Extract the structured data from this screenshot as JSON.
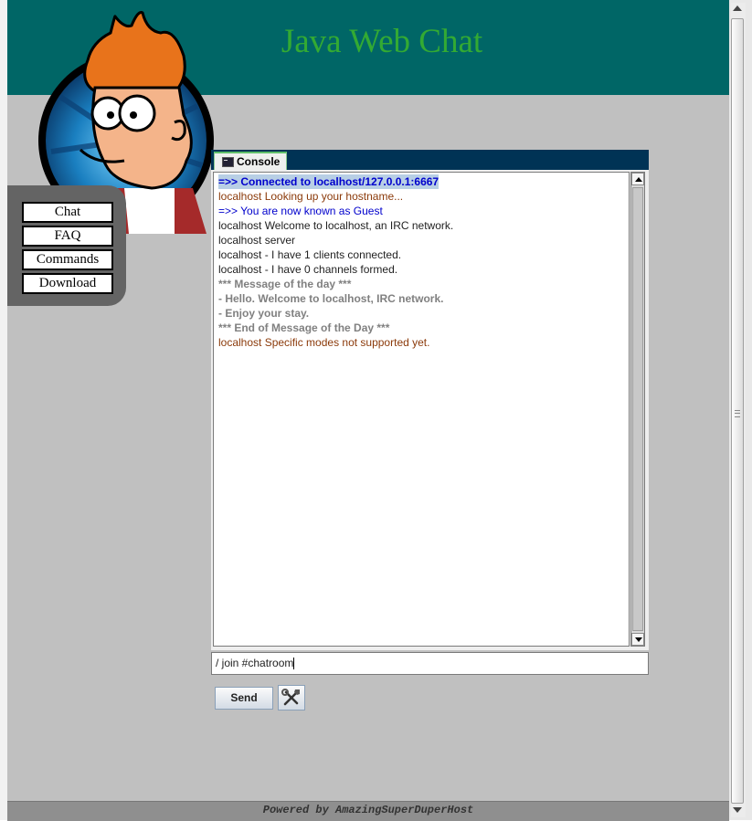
{
  "site": {
    "title": "Java Web Chat"
  },
  "nav": {
    "items": [
      {
        "label": "Chat"
      },
      {
        "label": "FAQ"
      },
      {
        "label": "Commands"
      },
      {
        "label": "Download"
      }
    ]
  },
  "applet": {
    "tabs": [
      {
        "label": "Console",
        "icon": "terminal-icon",
        "active": true
      }
    ],
    "messages": [
      {
        "text": "=>> Connected to localhost/127.0.0.1:6667",
        "style": "blue-selected"
      },
      {
        "text": "localhost Looking up your hostname...",
        "style": "brown"
      },
      {
        "text": "=>> You are now known as Guest",
        "style": "blue"
      },
      {
        "text": "localhost Welcome to localhost, an IRC network.",
        "style": "black"
      },
      {
        "text": "localhost server",
        "style": "black"
      },
      {
        "text": "localhost - I have 1 clients connected.",
        "style": "black"
      },
      {
        "text": "localhost - I have 0 channels formed.",
        "style": "black"
      },
      {
        "text": "*** Message of the day ***",
        "style": "gray"
      },
      {
        "text": "- Hello. Welcome to localhost, IRC network.",
        "style": "gray"
      },
      {
        "text": "- Enjoy your stay.",
        "style": "gray"
      },
      {
        "text": "*** End of Message of the Day ***",
        "style": "gray"
      },
      {
        "text": "localhost Specific modes not supported yet.",
        "style": "brown"
      }
    ],
    "input_value": "/ join #chatroom",
    "send_label": "Send",
    "tools_icon": "tools-icon"
  },
  "footer": {
    "text": "Powered by AmazingSuperDuperHost"
  },
  "colors": {
    "header_bg": "#006666",
    "title": "#33aa33",
    "page_bg": "#c0c0c0",
    "tab_strip": "#003355",
    "nav_panel": "#646464"
  }
}
